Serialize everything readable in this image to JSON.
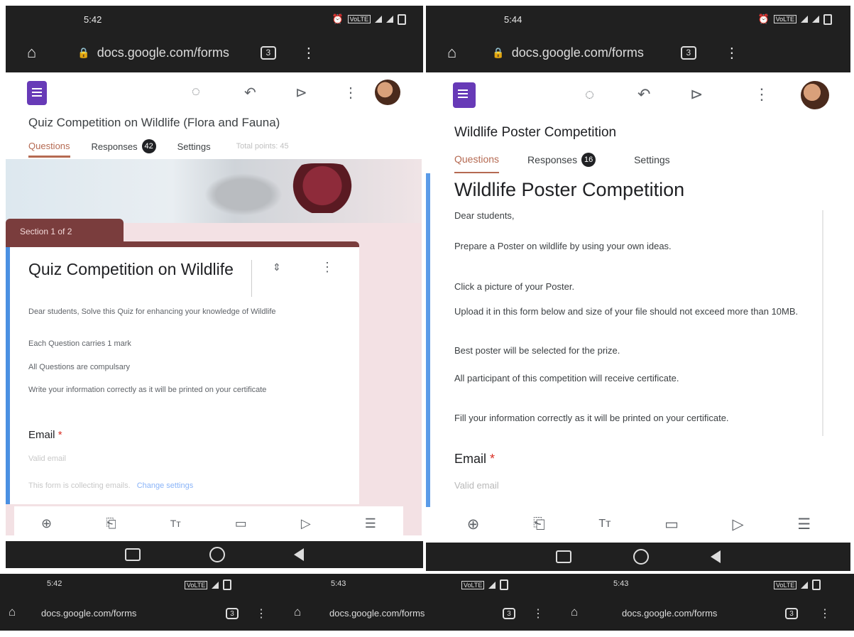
{
  "left": {
    "status_time": "5:42",
    "url": "docs.google.com/forms",
    "tab_count": "3",
    "menu_dots": "⋮",
    "form_title": "Quiz Competition on Wildlife (Flora and Fauna)",
    "tabs": [
      {
        "label": "Questions",
        "active": true
      },
      {
        "label": "Responses"
      },
      {
        "label": "Settings"
      }
    ],
    "responses_count": "42",
    "total_points_label": "Total points: 45",
    "section_label": "Section 1 of 2",
    "section_title": "Quiz Competition on Wildlife",
    "desc": [
      "Dear students, Solve this Quiz for enhancing your knowledge of Wildlife",
      "Each Question carries 1 mark",
      "All Questions are compulsary",
      "Write your information correctly as it will be printed  on your certificate"
    ],
    "email_label": "Email",
    "email_required": "*",
    "email_placeholder": "Valid email",
    "collecting_note": "This form is collecting emails.",
    "change_settings": "Change settings"
  },
  "right": {
    "status_time": "5:44",
    "url": "docs.google.com/forms",
    "tab_count": "3",
    "menu_dots": "⋮",
    "form_title": "Wildlife Poster Competition",
    "tabs": [
      {
        "label": "Questions",
        "active": true
      },
      {
        "label": "Responses"
      },
      {
        "label": "Settings"
      }
    ],
    "responses_count": "16",
    "section_title": "Wildlife Poster Competition",
    "desc": [
      "Dear students,",
      "Prepare a Poster on wildlife by using your own ideas.",
      "Click a picture of your Poster.",
      "Upload it in this form below and size of your file should not exceed more than 10MB.",
      "Best poster will be selected for the prize.",
      "All participant of this competition will receive certificate.",
      "Fill your information correctly as it will be printed on your certificate."
    ],
    "email_label": "Email",
    "email_required": "*",
    "email_placeholder": "Valid email"
  },
  "bottom_strips": [
    {
      "time": "5:42",
      "url": "docs.google.com/forms",
      "tab_count": "3"
    },
    {
      "time": "5:43",
      "url": "docs.google.com/forms",
      "tab_count": "3"
    },
    {
      "time": "5:43",
      "url": "docs.google.com/forms",
      "tab_count": "3"
    }
  ],
  "toolbar_icons": [
    "add-question-icon",
    "import-questions-icon",
    "add-title-icon",
    "add-image-icon",
    "add-video-icon",
    "add-section-icon"
  ],
  "colors": {
    "accent": "#b56a52",
    "form_purple": "#673ab7",
    "section_banner": "#7a3d3d",
    "dark_bar": "#202020"
  }
}
